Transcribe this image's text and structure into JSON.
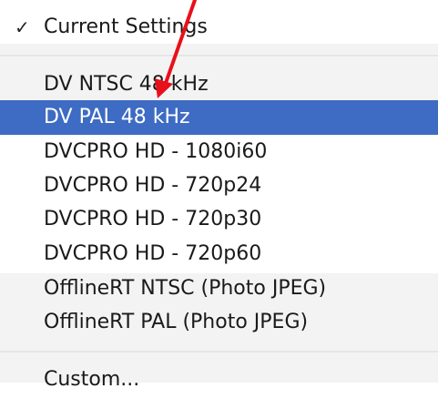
{
  "menu": {
    "current": {
      "label": "Current Settings",
      "checked": true
    },
    "items": [
      {
        "label": "DV NTSC 48 kHz",
        "selected": false
      },
      {
        "label": "DV PAL 48 kHz",
        "selected": true
      },
      {
        "label": "DVCPRO HD - 1080i60",
        "selected": false
      },
      {
        "label": "DVCPRO HD - 720p24",
        "selected": false
      },
      {
        "label": "DVCPRO HD - 720p30",
        "selected": false
      },
      {
        "label": "DVCPRO HD - 720p60",
        "selected": false
      },
      {
        "label": "OfflineRT NTSC (Photo JPEG)",
        "selected": false
      },
      {
        "label": "OfflineRT PAL (Photo JPEG)",
        "selected": false
      }
    ],
    "custom": {
      "label": "Custom..."
    }
  },
  "colors": {
    "highlight": "#3e6bc3",
    "annotation_arrow": "#e8101a"
  },
  "icons": {
    "check": "checkmark-icon",
    "annotation": "red-arrow-icon"
  }
}
